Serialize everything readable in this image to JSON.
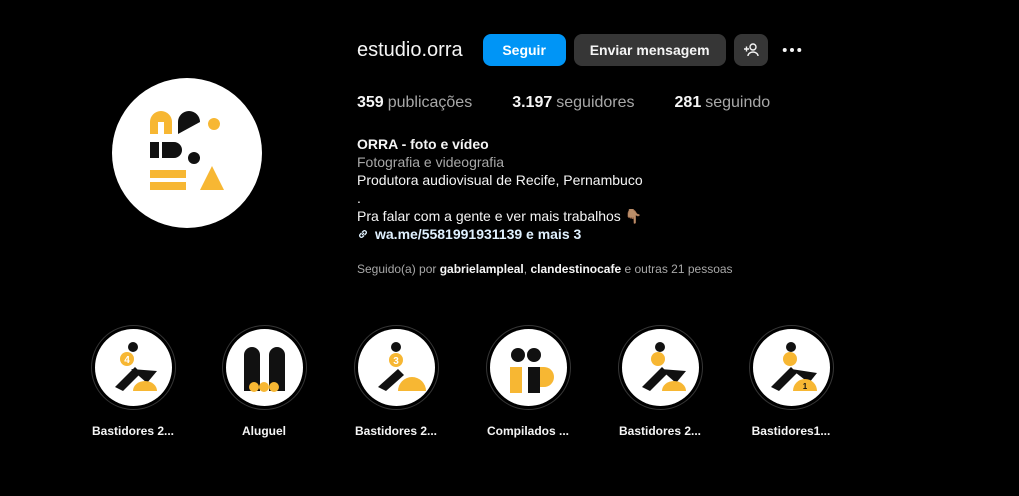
{
  "profile": {
    "username": "estudio.orra",
    "follow_label": "Seguir",
    "message_label": "Enviar mensagem",
    "suggest_icon": "add-person-icon",
    "more_icon": "more-dots-icon"
  },
  "stats": {
    "posts_count": "359",
    "posts_label": "publicações",
    "followers_count": "3.197",
    "followers_label": "seguidores",
    "following_count": "281",
    "following_label": "seguindo"
  },
  "bio": {
    "name": "ORRA - foto e vídeo",
    "category": "Fotografia e videografia",
    "line1": "Produtora audiovisual de Recife, Pernambuco",
    "line2": ".",
    "line3": "Pra falar com a gente e ver mais trabalhos 👇🏽",
    "link": "wa.me/5581991931139 e mais 3"
  },
  "followed_by": {
    "prefix": "Seguido(a) por ",
    "user1": "gabrielampleal",
    "sep": ", ",
    "user2": "clandestinocafe",
    "suffix": " e outras 21 pessoas"
  },
  "highlights": [
    {
      "label": "Bastidores 2..."
    },
    {
      "label": "Aluguel"
    },
    {
      "label": "Bastidores 2..."
    },
    {
      "label": "Compilados ..."
    },
    {
      "label": "Bastidores 2..."
    },
    {
      "label": "Bastidores1..."
    }
  ],
  "colors": {
    "accent": "#0095f6",
    "brand_yellow": "#f7b733",
    "brand_black": "#111111"
  }
}
